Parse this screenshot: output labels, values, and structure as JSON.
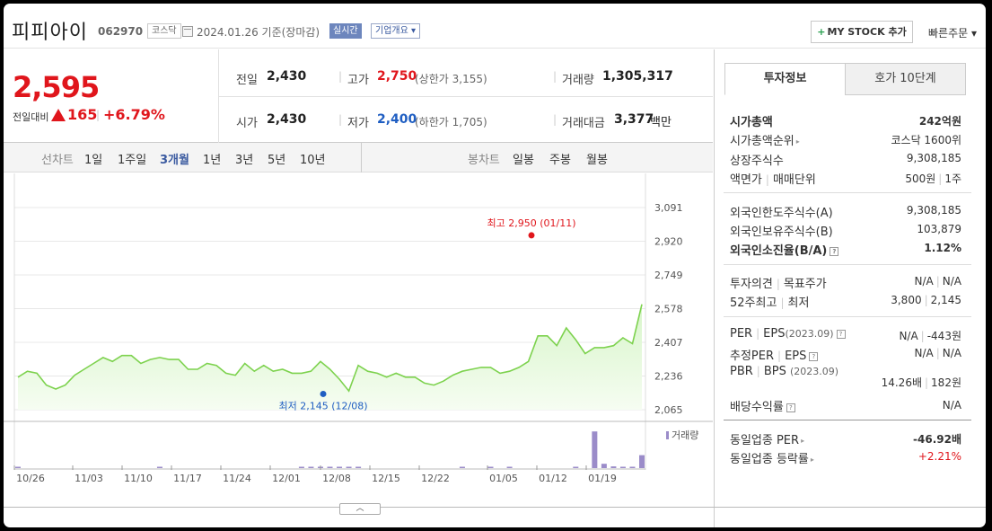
{
  "header": {
    "stock_name": "피피아이",
    "stock_code": "062970",
    "market": "코스닥",
    "date": "2024.01.26",
    "date_suffix": "기준(장마감)",
    "realtime_label": "실시간",
    "company_info_label": "기업개요",
    "mystock_label": "MY STOCK 추가",
    "quick_order_label": "빠른주문"
  },
  "summary": {
    "price": "2,595",
    "prev_diff_label": "전일대비",
    "change": "165",
    "change_pct": "+6.79%",
    "prev_close_label": "전일",
    "prev_close": "2,430",
    "open_label": "시가",
    "open": "2,430",
    "high_label": "고가",
    "high": "2,750",
    "upper_limit_label": "(상한가",
    "upper_limit": "3,155)",
    "low_label": "저가",
    "low": "2,400",
    "lower_limit_label": "(하한가",
    "lower_limit": "1,705)",
    "volume_label": "거래량",
    "volume": "1,305,317",
    "value_label": "거래대금",
    "value": "3,377",
    "value_unit": "백만"
  },
  "toolbar": {
    "line_chart_label": "선차트",
    "periods": [
      "1일",
      "1주일",
      "3개월",
      "1년",
      "3년",
      "5년",
      "10년"
    ],
    "active_period": "3개월",
    "candle_chart_label": "봉차트",
    "candle_periods": [
      "일봉",
      "주봉",
      "월봉"
    ]
  },
  "panel": {
    "tab_investment": "투자정보",
    "tab_orderbook": "호가 10단계",
    "rows": {
      "market_cap_label": "시가총액",
      "market_cap": "242억원",
      "market_cap_rank_label": "시가총액순위",
      "market_cap_rank": "코스닥 1600위",
      "shares_label": "상장주식수",
      "shares": "9,308,185",
      "par_label": "액면가",
      "trade_unit_label": "매매단위",
      "par": "500원",
      "trade_unit": "1주",
      "foreign_limit_label": "외국인한도주식수(A)",
      "foreign_limit": "9,308,185",
      "foreign_held_label": "외국인보유주식수(B)",
      "foreign_held": "103,879",
      "foreign_ratio_label": "외국인소진율(B/A)",
      "foreign_ratio": "1.12%",
      "opinion_label": "투자의견",
      "target_label": "목표주가",
      "opinion": "N/A",
      "target": "N/A",
      "w52_high_label": "52주최고",
      "w52_low_label": "최저",
      "w52_high": "3,800",
      "w52_low": "2,145",
      "per_label": "PER",
      "eps_label": "EPS",
      "eps_year": "(2023.09)",
      "per": "N/A",
      "eps": "-443원",
      "est_per_label": "추정PER",
      "est_eps_label": "EPS",
      "est_per": "N/A",
      "est_eps": "N/A",
      "pbr_label": "PBR",
      "bps_label": "BPS",
      "bps_year": "(2023.09)",
      "pbr": "14.26배",
      "bps": "182원",
      "dividend_label": "배당수익률",
      "dividend": "N/A",
      "sector_per_label": "동일업종 PER",
      "sector_per": "-46.92배",
      "sector_change_label": "동일업종 등락률",
      "sector_change": "+2.21%"
    }
  },
  "chart_data": {
    "type": "area",
    "x_ticks": [
      "10/26",
      "11/03",
      "11/10",
      "11/17",
      "11/24",
      "12/01",
      "12/08",
      "12/15",
      "12/22",
      "01/05",
      "01/12",
      "01/19"
    ],
    "y_ticks": [
      "3,091",
      "2,920",
      "2,749",
      "2,578",
      "2,407",
      "2,236",
      "2,065"
    ],
    "ylim": [
      2065,
      3091
    ],
    "price_series": [
      2230,
      2260,
      2250,
      2190,
      2170,
      2190,
      2240,
      2270,
      2300,
      2330,
      2310,
      2340,
      2340,
      2300,
      2320,
      2330,
      2320,
      2320,
      2270,
      2270,
      2300,
      2290,
      2250,
      2240,
      2300,
      2260,
      2290,
      2260,
      2270,
      2250,
      2250,
      2260,
      2310,
      2270,
      2220,
      2160,
      2290,
      2260,
      2250,
      2230,
      2250,
      2230,
      2230,
      2200,
      2190,
      2210,
      2240,
      2260,
      2270,
      2280,
      2280,
      2250,
      2260,
      2280,
      2310,
      2440,
      2440,
      2390,
      2480,
      2420,
      2350,
      2380,
      2380,
      2390,
      2430,
      2400,
      2600
    ],
    "high_annotation": {
      "label": "최고",
      "value": "2,950",
      "date": "(01/11)",
      "y": 2950
    },
    "low_annotation": {
      "label": "최저",
      "value": "2,145",
      "date": "(12/08)",
      "y": 2145
    },
    "volume_label": "거래량",
    "volume_series": [
      0.02,
      0,
      0,
      0,
      0,
      0,
      0,
      0,
      0,
      0,
      0,
      0,
      0,
      0,
      0,
      0.01,
      0,
      0,
      0,
      0,
      0,
      0,
      0,
      0,
      0,
      0,
      0,
      0,
      0,
      0,
      0.01,
      0.01,
      0.01,
      0.01,
      0.01,
      0.01,
      0.01,
      0,
      0,
      0,
      0,
      0,
      0,
      0,
      0,
      0,
      0,
      0.01,
      0,
      0,
      0.01,
      0,
      0.01,
      0,
      0,
      0,
      0,
      0,
      0,
      0.01,
      0,
      0.85,
      0.1,
      0.04,
      0.02,
      0.02,
      0.3
    ],
    "grid": true
  }
}
